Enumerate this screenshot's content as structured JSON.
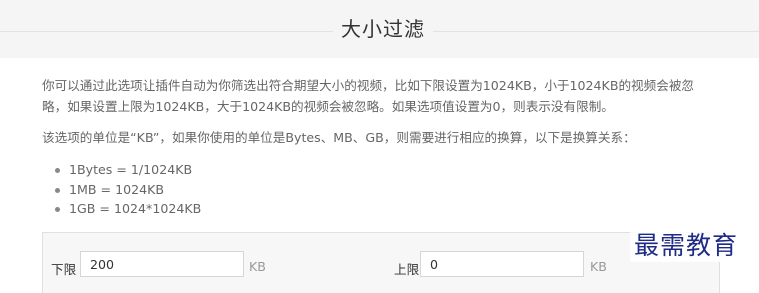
{
  "header": {
    "title": "大小过滤"
  },
  "intro": {
    "line1": "你可以通过此选项让插件自动为你筛选出符合期望大小的视频，比如下限设置为1024KB，小于1024KB的视频会被忽",
    "line2": "略，如果设置上限为1024KB，大于1024KB的视频会被忽略。如果选项值设置为0，则表示没有限制。"
  },
  "unit_note": "该选项的单位是“KB”，如果你使用的单位是Bytes、MB、GB，则需要进行相应的换算，以下是换算关系：",
  "conversions": [
    "1Bytes = 1/1024KB",
    "1MB = 1024KB",
    "1GB = 1024*1024KB"
  ],
  "form": {
    "lower": {
      "label": "下限",
      "value": "200",
      "unit": "KB"
    },
    "upper": {
      "label": "上限",
      "value": "0",
      "unit": "KB"
    }
  },
  "watermark": "最需教育"
}
